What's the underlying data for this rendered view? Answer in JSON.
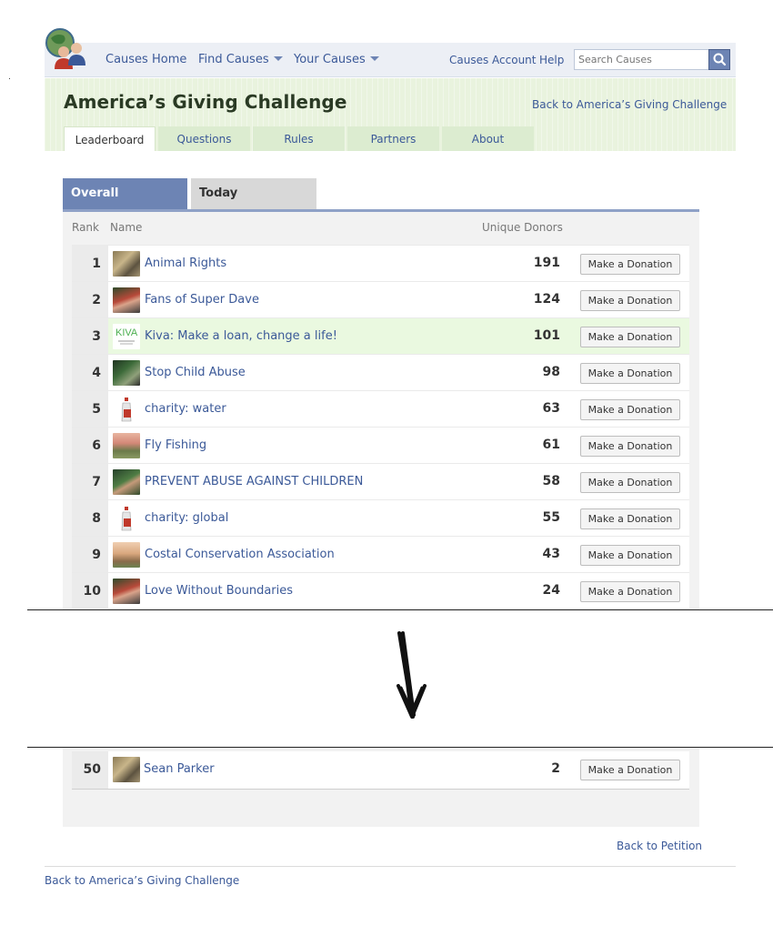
{
  "nav": {
    "causes_home": "Causes Home",
    "find_causes": "Find Causes",
    "your_causes": "Your Causes",
    "causes_account": "Causes Account",
    "help": "Help",
    "search_placeholder": "Search Causes"
  },
  "header": {
    "title": "America’s Giving Challenge",
    "back_link": "Back to America’s Giving Challenge",
    "tabs": [
      "Leaderboard",
      "Questions",
      "Rules",
      "Partners",
      "About"
    ]
  },
  "leaderboard": {
    "tabs": [
      "Overall",
      "Today"
    ],
    "columns": {
      "rank": "Rank",
      "name": "Name",
      "donors": "Unique Donors"
    },
    "button_label": "Make a Donation",
    "rows": [
      {
        "rank": "1",
        "name": "Animal Rights",
        "donors": "191"
      },
      {
        "rank": "2",
        "name": "Fans of Super Dave",
        "donors": "124"
      },
      {
        "rank": "3",
        "name": "Kiva: Make a loan, change a life!",
        "donors": "101"
      },
      {
        "rank": "4",
        "name": "Stop Child Abuse",
        "donors": "98"
      },
      {
        "rank": "5",
        "name": "charity: water",
        "donors": "63"
      },
      {
        "rank": "6",
        "name": "Fly Fishing",
        "donors": "61"
      },
      {
        "rank": "7",
        "name": "PREVENT ABUSE AGAINST CHILDREN",
        "donors": "58"
      },
      {
        "rank": "8",
        "name": "charity: global",
        "donors": "55"
      },
      {
        "rank": "9",
        "name": "Costal Conservation Association",
        "donors": "43"
      },
      {
        "rank": "10",
        "name": "Love Without Boundaries",
        "donors": "24"
      }
    ],
    "last_row": {
      "rank": "50",
      "name": "Sean Parker",
      "donors": "2"
    }
  },
  "footer": {
    "back_petition": "Back to Petition",
    "back_challenge": "Back to America’s Giving Challenge"
  },
  "kiva_logo_text": "KIVA",
  "colors": {
    "link": "#3b5998",
    "tab_active": "#6d84b4",
    "header_bg": "#e9f3de",
    "highlight_row": "#eaf9e0"
  }
}
